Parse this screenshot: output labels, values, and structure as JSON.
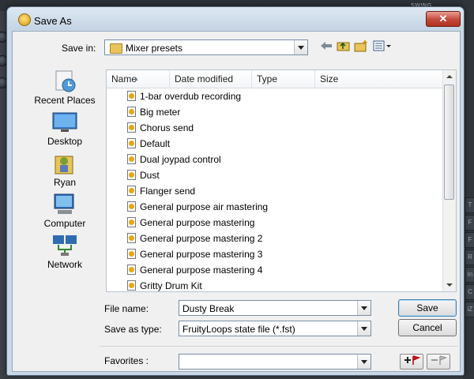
{
  "window": {
    "title": "Save As",
    "close_label": "✕"
  },
  "background": {
    "swing_label": "SWING",
    "right_tabs": [
      "T",
      "F",
      "F",
      "R",
      "In",
      "C",
      "iZ"
    ]
  },
  "save_in": {
    "label": "Save in:",
    "value": "Mixer presets"
  },
  "toolbar": {
    "back_icon": "back-arrow-icon",
    "up_icon": "up-folder-icon",
    "new_folder_icon": "new-folder-icon",
    "views_icon": "views-menu-icon"
  },
  "places": [
    {
      "label": "Recent Places",
      "icon": "recent-places-icon"
    },
    {
      "label": "Desktop",
      "icon": "desktop-icon"
    },
    {
      "label": "Ryan",
      "icon": "user-folder-icon"
    },
    {
      "label": "Computer",
      "icon": "computer-icon"
    },
    {
      "label": "Network",
      "icon": "network-icon"
    }
  ],
  "columns": [
    "Name",
    "Date modified",
    "Type",
    "Size"
  ],
  "files": [
    "1-bar overdub recording",
    "Big meter",
    "Chorus send",
    "Default",
    "Dual joypad control",
    "Dust",
    "Flanger send",
    "General purpose air mastering",
    "General purpose mastering",
    "General purpose mastering 2",
    "General purpose mastering 3",
    "General purpose mastering 4",
    "Gritty Drum Kit"
  ],
  "filename": {
    "label": "File name:",
    "value": "Dusty Break"
  },
  "save_as_type": {
    "label": "Save as type:",
    "value": "FruityLoops state file (*.fst)"
  },
  "favorites": {
    "label": "Favorites :",
    "value": ""
  },
  "buttons": {
    "save": "Save",
    "cancel": "Cancel"
  },
  "colors": {
    "title_bar": "#c5d4e4",
    "close_button": "#c4473a",
    "dialog_body": "#f0f0f0"
  }
}
